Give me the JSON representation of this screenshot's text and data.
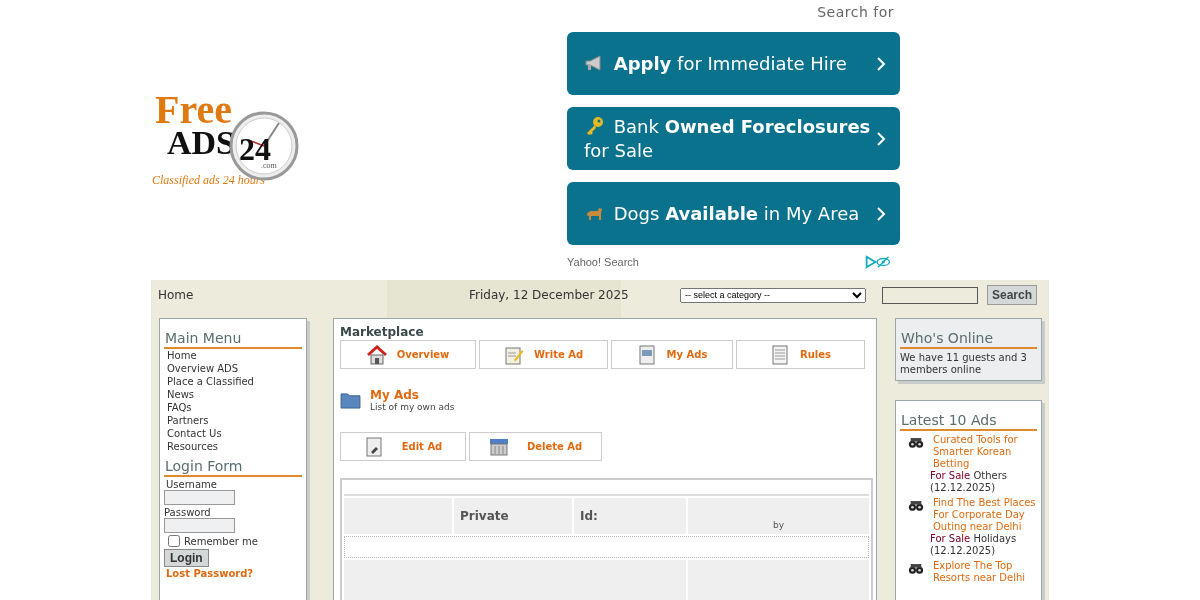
{
  "logo": {
    "word1": "Free",
    "word2": "ADS",
    "number": "24",
    "suffix": ".com",
    "tagline": "Classified ads 24 hours"
  },
  "ad_block": {
    "heading": "Search for",
    "links": [
      {
        "text": "**Apply** for Immediate Hire"
      },
      {
        "text": "Bank **Owned Foreclosures** for Sale"
      },
      {
        "text": "Dogs **Available** in My Area"
      }
    ],
    "provider": "Yahoo! Search"
  },
  "top_bar": {
    "home": "Home",
    "date": "Friday, 12 December 2025",
    "category_select": "-- select a category --",
    "search_button": "Search"
  },
  "main_menu": {
    "title": "Main Menu",
    "items": [
      "Home",
      "Overview ADS",
      "Place a Classified",
      "News",
      "FAQs",
      "Partners",
      "Contact Us",
      "Resources"
    ]
  },
  "login_form": {
    "title": "Login Form",
    "username_label": "Username",
    "password_label": "Password",
    "remember": {
      "label": "Remember me",
      "checked": false
    },
    "login_button": "Login",
    "lost_password": "Lost Password?"
  },
  "marketplace": {
    "title": "Marketplace",
    "tabs": [
      {
        "label": "Overview"
      },
      {
        "label": "Write Ad"
      },
      {
        "label": "My Ads"
      },
      {
        "label": "Rules"
      }
    ],
    "section": {
      "title": "My Ads",
      "subtitle": "List of my own ads"
    },
    "actions": [
      {
        "label": "Edit Ad"
      },
      {
        "label": "Delete Ad"
      }
    ],
    "listing": {
      "column_2": "Private",
      "column_3": "Id:",
      "column_4": "by"
    }
  },
  "whos_online": {
    "title": "Who's Online",
    "text": "We have 11 guests and 3 members online"
  },
  "latest_ads": {
    "title": "Latest 10 Ads",
    "items": [
      {
        "title": "Curated Tools for Smarter Korean Betting",
        "type": "For Sale",
        "category": "Others",
        "date": "(12.12.2025)"
      },
      {
        "title": "Find The Best Places For Corporate Day Outing near Delhi",
        "type": "For Sale",
        "category": "Holidays",
        "date": "(12.12.2025)"
      },
      {
        "title": "Explore The Top Resorts near Delhi"
      }
    ]
  }
}
